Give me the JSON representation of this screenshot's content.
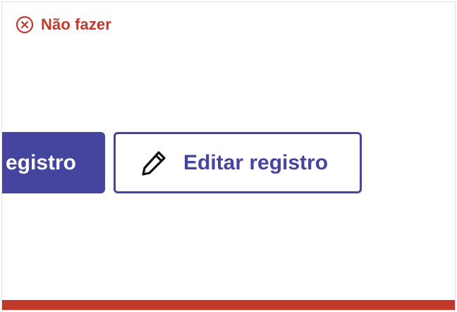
{
  "header": {
    "label": "Não fazer",
    "icon": "close-circle-icon",
    "color": "#c0392b"
  },
  "buttons": {
    "primary": {
      "label": "egistro",
      "color": "#4545a0"
    },
    "secondary": {
      "label": "Editar registro",
      "icon": "pencil-icon",
      "color": "#4545a0"
    }
  },
  "status_bar_color": "#c0392b"
}
